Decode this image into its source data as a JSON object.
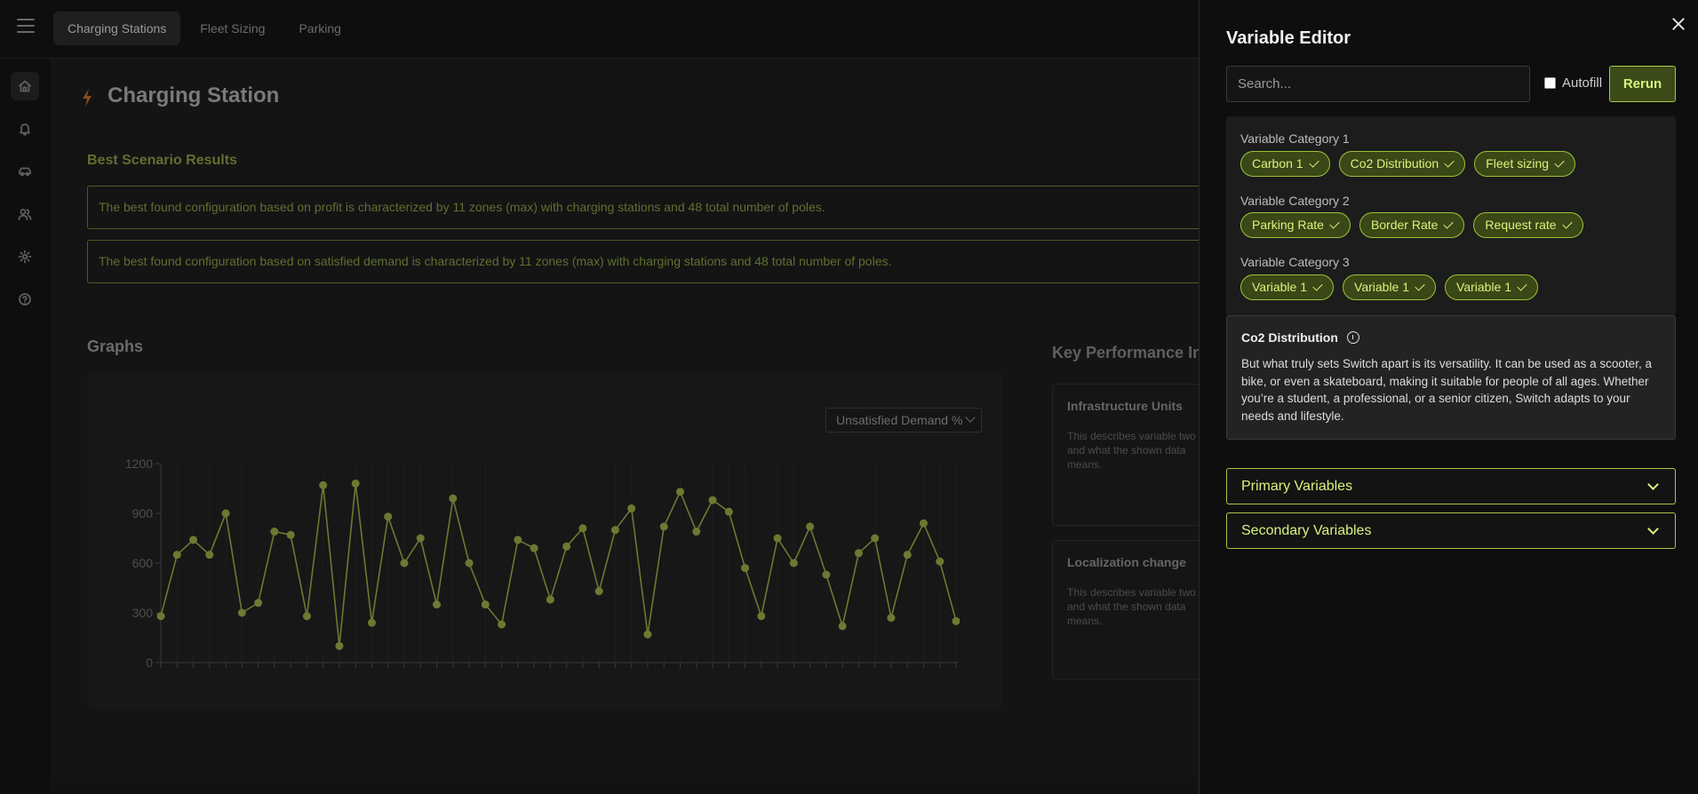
{
  "topbar": {
    "tabs": [
      {
        "label": "Charging Stations",
        "active": true
      },
      {
        "label": "Fleet Sizing",
        "active": false
      },
      {
        "label": "Parking",
        "active": false
      }
    ]
  },
  "sidebar": {
    "icons": [
      "home-icon",
      "bell-icon",
      "car-icon",
      "users-icon",
      "gear-icon",
      "help-icon"
    ]
  },
  "page": {
    "title": "Charging Station",
    "best_section_title": "Best Scenario Results",
    "results": [
      "The best found configuration based on profit is characterized by 11 zones (max) with charging stations and 48 total number of poles.",
      "The best found configuration based on satisfied demand is characterized by 11 zones (max) with charging stations and 48 total number of poles."
    ],
    "graphs_title": "Graphs",
    "kpi_title": "Key Performance Indicators",
    "graph_select": "Unsatisfied Demand %",
    "kpis": [
      {
        "title": "Infrastructure Units",
        "desc": "This describes variable two and what the shown data means."
      },
      {
        "title": "Localization change",
        "desc": "This describes variable two and what the shown data means."
      }
    ]
  },
  "chart_data": {
    "type": "line",
    "ylim": [
      0,
      1200
    ],
    "yticks": [
      "0",
      "300",
      "600",
      "900",
      "1200"
    ],
    "values": [
      280,
      650,
      740,
      650,
      900,
      300,
      360,
      790,
      770,
      280,
      1070,
      100,
      1080,
      240,
      880,
      600,
      750,
      350,
      990,
      600,
      350,
      230,
      740,
      690,
      380,
      700,
      810,
      430,
      800,
      930,
      170,
      820,
      1030,
      790,
      980,
      910,
      570,
      280,
      750,
      600,
      820,
      530,
      220,
      660,
      750,
      270,
      650,
      840,
      610,
      250
    ],
    "color": "#6b7a32"
  },
  "panel": {
    "title": "Variable Editor",
    "search_placeholder": "Search...",
    "autofill_label": "Autofill",
    "rerun_label": "Rerun",
    "categories": [
      {
        "label": "Variable Category 1",
        "chips": [
          "Carbon 1",
          "Co2 Distribution",
          "Fleet sizing"
        ]
      },
      {
        "label": "Variable Category 2",
        "chips": [
          "Parking Rate",
          "Border Rate",
          "Request rate"
        ]
      },
      {
        "label": "Variable Category 3",
        "chips": [
          "Variable 1",
          "Variable 1",
          "Variable 1"
        ]
      }
    ],
    "description": {
      "title": "Co2 Distribution",
      "text": "But what truly sets Switch apart is its versatility. It can be used as a scooter, a bike, or even a skateboard, making it suitable for people of all ages. Whether you’re a student, a professional, or a senior citizen, Switch adapts to your needs and lifestyle."
    },
    "accordions": [
      "Primary Variables",
      "Secondary Variables"
    ]
  },
  "colors": {
    "accent": "#d9f27e",
    "accent_border": "#a8c84a",
    "chip_bg": "#3a4716",
    "bolt": "#8a4a1c"
  }
}
